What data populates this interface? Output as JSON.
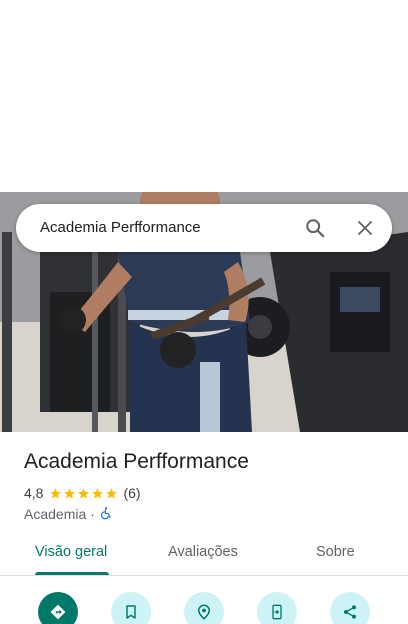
{
  "search": {
    "query": "Academia Perfformance"
  },
  "place": {
    "name": "Academia Perfformance",
    "rating": "4,8",
    "rating_value": 4.8,
    "review_count": "(6)",
    "category": "Academia",
    "separator": "·",
    "accessibility_icon": "wheelchair-icon"
  },
  "tabs": [
    {
      "label": "Visão geral",
      "active": true
    },
    {
      "label": "Avaliações",
      "active": false
    },
    {
      "label": "Sobre",
      "active": false
    }
  ],
  "actions": [
    {
      "icon": "directions-icon"
    },
    {
      "icon": "save-bookmark-icon"
    },
    {
      "icon": "nearby-icon"
    },
    {
      "icon": "send-to-phone-icon"
    },
    {
      "icon": "share-icon"
    }
  ],
  "colors": {
    "accent": "#00796b",
    "star": "#fbbc04",
    "action_bg": "#cdf3f6",
    "accessibility": "#1a73e8"
  }
}
